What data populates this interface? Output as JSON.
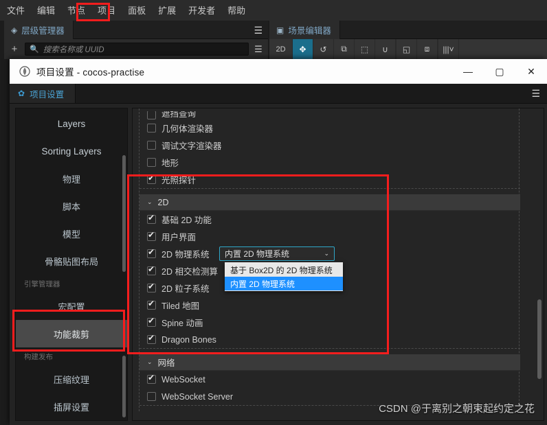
{
  "editor": {
    "menu_items": [
      "文件",
      "编辑",
      "节点",
      "项目",
      "面板",
      "扩展",
      "开发者",
      "帮助"
    ],
    "hierarchy_tab": {
      "label": "层级管理器",
      "icon": "layers-icon"
    },
    "hierarchy_search_placeholder": "搜索名称或 UUID",
    "hierarchy_add_icon": "plus-icon",
    "hierarchy_list_icon": "list-icon",
    "hierarchy_menu_icon": "hamburger-icon",
    "scene_tab": {
      "label": "场景编辑器",
      "icon": "scene-icon"
    },
    "scene_toolbar": [
      {
        "name": "2d-toggle",
        "label": "2D",
        "active": false
      },
      {
        "name": "move-tool",
        "label": "✥",
        "active": true
      },
      {
        "name": "rotate-tool",
        "label": "↺",
        "active": false
      },
      {
        "name": "scale-tool",
        "label": "⧉",
        "active": false
      },
      {
        "name": "rect-tool",
        "label": "⬚",
        "active": false
      },
      {
        "name": "magnet-tool",
        "label": "∪",
        "active": false
      },
      {
        "name": "pivot-tool",
        "label": "◱",
        "active": false
      },
      {
        "name": "coordinate-tool",
        "label": "⧈",
        "active": false
      },
      {
        "name": "gizmo-dropdown",
        "label": "|||˅",
        "active": false
      }
    ]
  },
  "dialog": {
    "title": "项目设置 - cocos-practise",
    "logo_icon": "cocos-logo-icon",
    "window_controls": [
      {
        "name": "minimize-button",
        "glyph": "—"
      },
      {
        "name": "maximize-button",
        "glyph": "▢"
      },
      {
        "name": "close-button",
        "glyph": "✕"
      }
    ],
    "tab": {
      "label": "项目设置",
      "icon": "gear-icon"
    },
    "menu_icon": "hamburger-icon"
  },
  "sidebar": {
    "items": [
      {
        "label": "Layers",
        "latin": true,
        "selected": false
      },
      {
        "label": "Sorting Layers",
        "latin": true,
        "selected": false
      },
      {
        "label": "物理",
        "latin": false,
        "selected": false
      },
      {
        "label": "脚本",
        "latin": false,
        "selected": false
      },
      {
        "label": "模型",
        "latin": false,
        "selected": false
      },
      {
        "label": "骨骼贴图布局",
        "latin": false,
        "selected": false
      }
    ],
    "group_engine": "引擎管理器",
    "items_engine": [
      {
        "label": "宏配置",
        "selected": false
      },
      {
        "label": "功能裁剪",
        "selected": true
      }
    ],
    "group_build": "构建发布",
    "items_build": [
      {
        "label": "压缩纹理",
        "selected": false
      },
      {
        "label": "插屏设置",
        "selected": false
      }
    ]
  },
  "content": {
    "top_rows": [
      {
        "label": "遮挡查询",
        "checked": false,
        "clipped": true
      },
      {
        "label": "几何体渲染器",
        "checked": false
      },
      {
        "label": "调试文字渲染器",
        "checked": false
      },
      {
        "label": "地形",
        "checked": false
      },
      {
        "label": "光照探针",
        "checked": true
      }
    ],
    "group_2d": {
      "label": "2D",
      "caret": "⌄"
    },
    "rows_2d": [
      {
        "label": "基础 2D 功能",
        "checked": true,
        "has_select": false
      },
      {
        "label": "用户界面",
        "checked": true,
        "has_select": false
      },
      {
        "label": "2D 物理系统",
        "checked": true,
        "has_select": true
      },
      {
        "label": "2D 相交检测算",
        "checked": true,
        "has_select": false
      },
      {
        "label": "2D 粒子系统",
        "checked": true,
        "has_select": false
      },
      {
        "label": "Tiled 地图",
        "checked": true,
        "has_select": false
      },
      {
        "label": "Spine 动画",
        "checked": true,
        "has_select": false
      },
      {
        "label": "Dragon Bones",
        "checked": true,
        "has_select": false
      }
    ],
    "physics_select": {
      "value": "内置 2D 物理系统",
      "chevron": "⌄",
      "options": [
        {
          "label": "基于 Box2D 的 2D 物理系统",
          "highlighted": false
        },
        {
          "label": "内置 2D 物理系统",
          "highlighted": true
        }
      ]
    },
    "group_network": {
      "label": "网络",
      "caret": "⌄"
    },
    "rows_network": [
      {
        "label": "WebSocket",
        "checked": true
      },
      {
        "label": "WebSocket Server",
        "checked": false
      }
    ]
  },
  "annotations": {
    "watermark": "CSDN @于离别之朝束起约定之花",
    "highlight_color": "#f51d1d"
  }
}
